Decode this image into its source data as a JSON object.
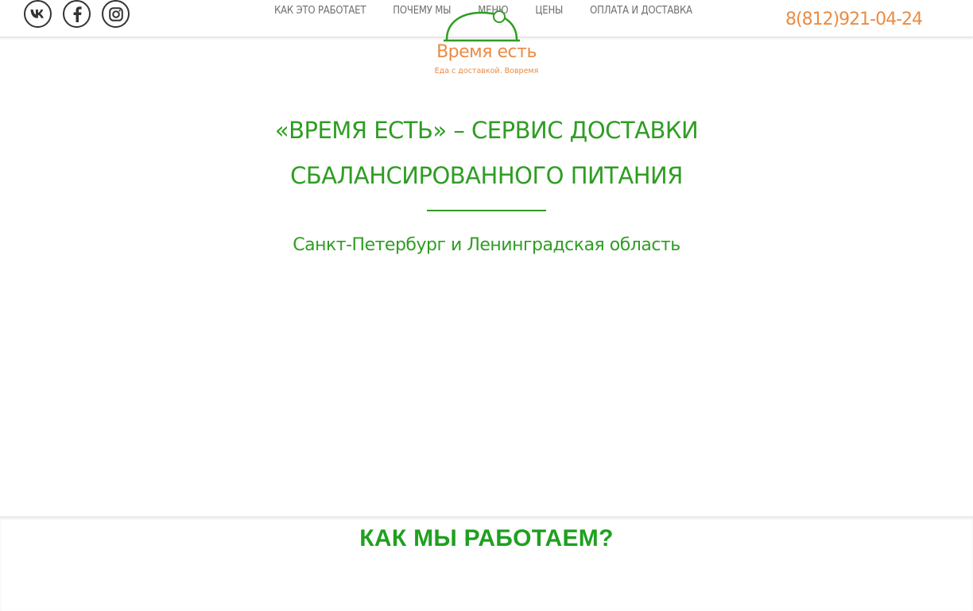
{
  "header": {
    "social": [
      {
        "icon": "vk-icon"
      },
      {
        "icon": "facebook-icon"
      },
      {
        "icon": "instagram-icon"
      }
    ],
    "nav": [
      {
        "label": "КАК ЭТО РАБОТАЕТ"
      },
      {
        "label": "ПОЧЕМУ МЫ"
      },
      {
        "label": "МЕНЮ"
      },
      {
        "label": "ЦЕНЫ"
      },
      {
        "label": "ОПЛАТА И ДОСТАВКА"
      }
    ],
    "phone": "8(812)921-04-24"
  },
  "logo": {
    "name": "Время есть",
    "tagline": "Еда с доставкой. Вовремя",
    "icon": "cloche-icon"
  },
  "hero": {
    "title_line1": "«ВРЕМЯ ЕСТЬ» – СЕРВИС ДОСТАВКИ",
    "title_line2": "СБАЛАНСИРОВАННОГО ПИТАНИЯ",
    "subtitle": "Санкт-Петербург и Ленинградская область"
  },
  "section": {
    "title": "КАК МЫ РАБОТАЕМ?"
  },
  "colors": {
    "green": "#2f9d23",
    "orange": "#e98c45",
    "nav_text": "#6e6e6e"
  }
}
